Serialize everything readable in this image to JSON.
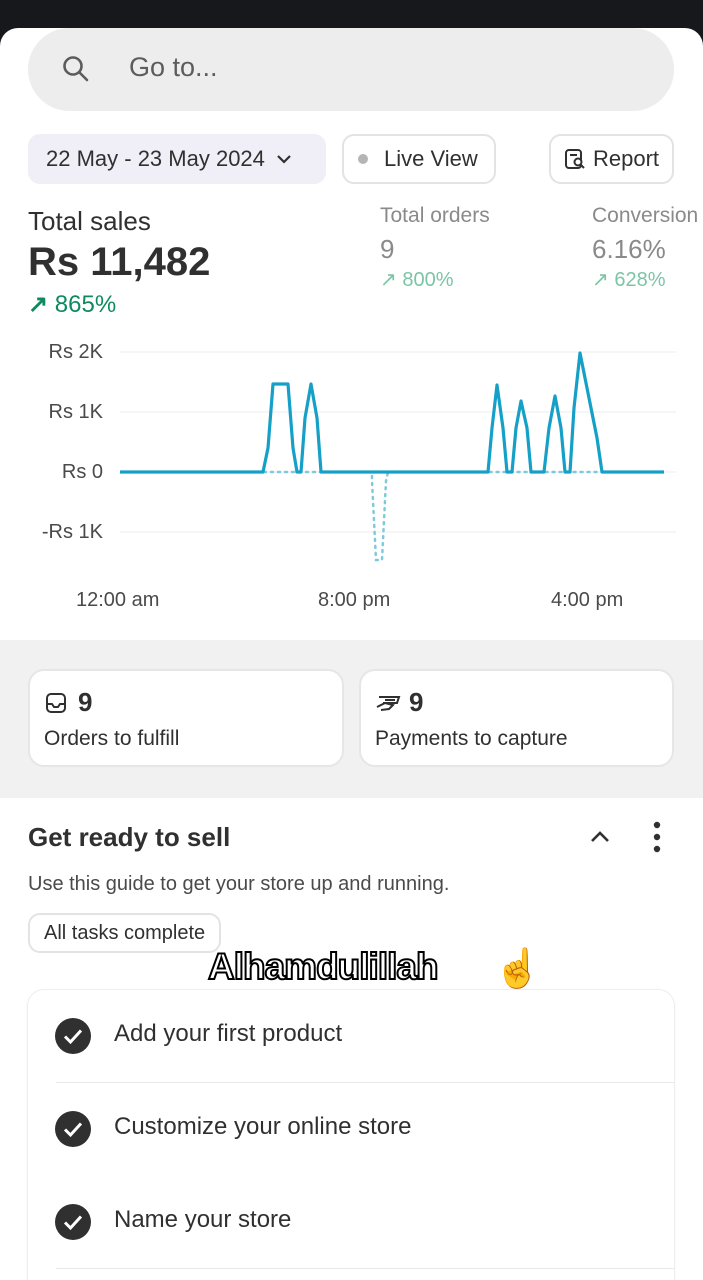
{
  "search": {
    "placeholder": "Go to...",
    "icon": "search-icon"
  },
  "filters": {
    "date_range": "22 May - 23 May 2024",
    "live_view": "Live View",
    "report": "Report"
  },
  "metrics": {
    "total_sales": {
      "label": "Total sales",
      "value": "Rs 11,482",
      "change": "865%"
    },
    "total_orders": {
      "label": "Total orders",
      "value": "9",
      "change": "800%"
    },
    "conversion": {
      "label": "Conversion",
      "value": "6.16%",
      "change": "628%"
    }
  },
  "chart_data": {
    "type": "line",
    "y_tick_labels": [
      "Rs 2K",
      "Rs 1K",
      "Rs 0",
      "-Rs 1K"
    ],
    "x_tick_labels": [
      "12:00 am",
      "8:00 pm",
      "4:00 pm"
    ],
    "ylim": [
      -1500,
      2000
    ],
    "grid": true,
    "colors": {
      "current": "#16a0c8",
      "comparison": "#7fc9dc"
    }
  },
  "cards": [
    {
      "count": "9",
      "label": "Orders to fulfill",
      "icon": "inbox-icon"
    },
    {
      "count": "9",
      "label": "Payments to capture",
      "icon": "cash-icon"
    }
  ],
  "setup": {
    "title": "Get ready to sell",
    "description": "Use this guide to get your store up and running.",
    "badge": "All tasks complete",
    "tasks": [
      {
        "label": "Add your first product"
      },
      {
        "label": "Customize your online store"
      },
      {
        "label": "Name your store"
      }
    ]
  },
  "overlay": {
    "caption": "Alhamdulillah",
    "emoji": "☝️"
  }
}
